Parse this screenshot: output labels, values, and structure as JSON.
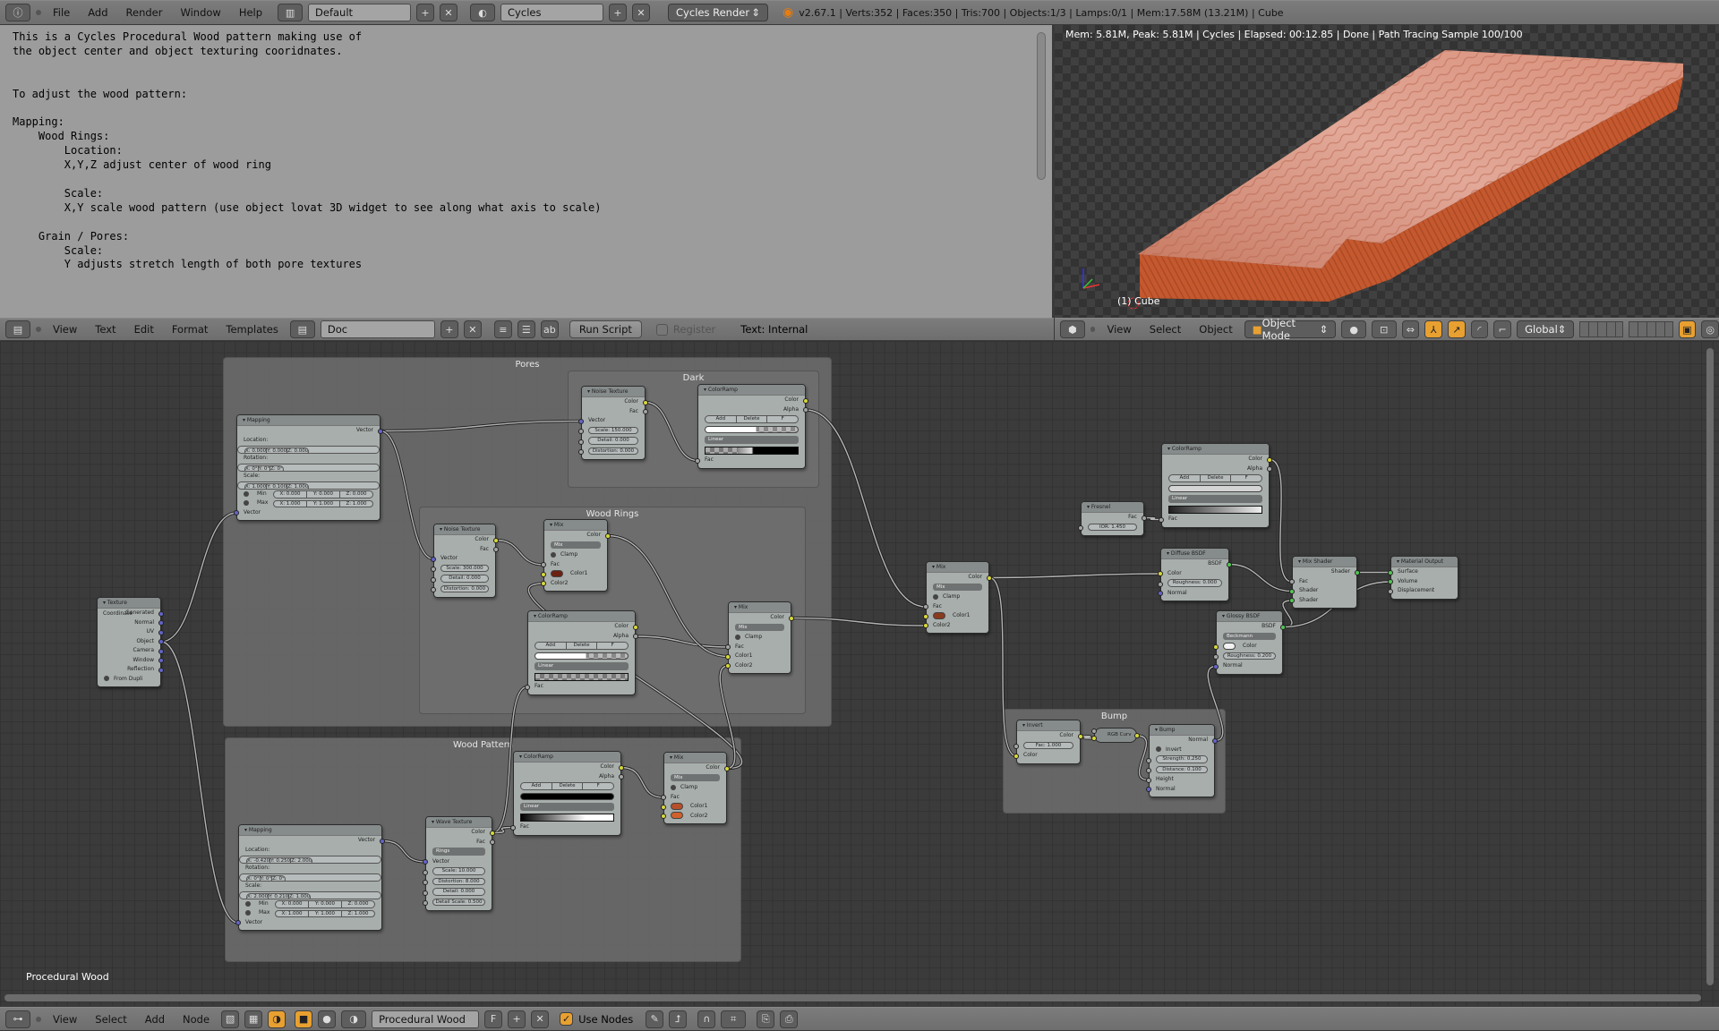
{
  "topbar": {
    "menus": [
      "File",
      "Add",
      "Render",
      "Window",
      "Help"
    ],
    "screen_layout": "Default",
    "scene": "Cycles",
    "render_engine": "Cycles Render",
    "stats": "v2.67.1 | Verts:352 | Faces:350 | Tris:700 | Objects:1/3 | Lamps:0/1 | Mem:17.58M (13.21M) | Cube"
  },
  "text_editor": {
    "lines": [
      "This is a Cycles Procedural Wood pattern making use of",
      "the object center and object texturing cooridnates.",
      "",
      "",
      "To adjust the wood pattern:",
      "",
      "Mapping:",
      "    Wood Rings:",
      "        Location:",
      "        X,Y,Z adjust center of wood ring",
      "",
      "        Scale:",
      "        X,Y scale wood pattern (use object lovat 3D widget to see along what axis to scale)",
      "",
      "    Grain / Pores:",
      "        Scale:",
      "        Y adjusts stretch length of both pore textures"
    ],
    "header": {
      "menus": [
        "View",
        "Text",
        "Edit",
        "Format",
        "Templates"
      ],
      "datablock": "Doc",
      "run_script": "Run Script",
      "register": "Register",
      "register_checked": false,
      "status": "Text: Internal"
    }
  },
  "viewport": {
    "render_info": "Mem: 5.81M, Peak: 5.81M | Cycles | Elapsed: 00:12.85 | Done | Path Tracing Sample 100/100",
    "object_label": "(1) Cube",
    "header": {
      "menus": [
        "View",
        "Select",
        "Object"
      ],
      "mode": "Object Mode",
      "orientation": "Global"
    },
    "colors": {
      "top": "#d99a88",
      "side": "#c4582e",
      "grain": "#b8624c"
    }
  },
  "node_editor": {
    "material_label": "Procedural Wood",
    "frames": {
      "pores": "Pores",
      "dark": "Dark",
      "wood_rings": "Wood Rings",
      "wood_pattern": "Wood Pattern",
      "bump": "Bump"
    },
    "nodes": {
      "texcoord": {
        "title": "Texture Coordinate",
        "rows": [
          {
            "t": "out",
            "l": "Generated",
            "s": "v"
          },
          {
            "t": "out",
            "l": "Normal",
            "s": "v"
          },
          {
            "t": "out",
            "l": "UV",
            "s": "v"
          },
          {
            "t": "out",
            "l": "Object",
            "s": "v"
          },
          {
            "t": "out",
            "l": "Camera",
            "s": "v"
          },
          {
            "t": "out",
            "l": "Window",
            "s": "v"
          },
          {
            "t": "out",
            "l": "Reflection",
            "s": "v"
          },
          {
            "t": "check",
            "l": "From Dupli"
          }
        ]
      },
      "mapping1": {
        "title": "Mapping",
        "rows": [
          {
            "t": "out",
            "l": "Vector",
            "s": "v"
          },
          {
            "t": "label",
            "l": "Location:"
          },
          {
            "t": "tri",
            "v": [
              "X: 0.000",
              "Y: 0.000",
              "Z: 0.000"
            ]
          },
          {
            "t": "label",
            "l": "Rotation:"
          },
          {
            "t": "tri",
            "v": [
              "X: 0°",
              "Y: 0°",
              "Z: 0°"
            ]
          },
          {
            "t": "label",
            "l": "Scale:"
          },
          {
            "t": "tri",
            "v": [
              "X: 1.000",
              "Y: 0.100",
              "Z: 1.000"
            ]
          },
          {
            "t": "minmax",
            "l": "Min",
            "v": [
              "X: 0.000",
              "Y: 0.000",
              "Z: 0.000"
            ]
          },
          {
            "t": "minmax",
            "l": "Max",
            "v": [
              "X: 1.000",
              "Y: 1.000",
              "Z: 1.000"
            ]
          },
          {
            "t": "in",
            "l": "Vector",
            "s": "v"
          }
        ]
      },
      "noiseDark": {
        "title": "Noise Texture",
        "rows": [
          {
            "t": "out",
            "l": "Color",
            "s": "c"
          },
          {
            "t": "out",
            "l": "Fac",
            "s": "f"
          },
          {
            "t": "in",
            "l": "Vector",
            "s": "v"
          },
          {
            "t": "infield",
            "l": "Scale: 150.000",
            "s": "f"
          },
          {
            "t": "infield",
            "l": "Detail: 0.000",
            "s": "f"
          },
          {
            "t": "infield",
            "l": "Distortion: 0.000",
            "s": "f"
          }
        ]
      },
      "rampDark": {
        "title": "ColorRamp",
        "rows": [
          {
            "t": "out",
            "l": "Color",
            "s": "c"
          },
          {
            "t": "out",
            "l": "Alpha",
            "s": "f"
          },
          {
            "t": "buttons",
            "v": [
              "Add",
              "Delete",
              "F"
            ]
          },
          {
            "t": "colorbar",
            "k": "white_checker"
          },
          {
            "t": "dropdown",
            "l": "Linear"
          },
          {
            "t": "ramp",
            "k": "checker_black"
          },
          {
            "t": "in",
            "l": "Fac",
            "s": "f"
          }
        ]
      },
      "noiseWR": {
        "title": "Noise Texture",
        "rows": [
          {
            "t": "out",
            "l": "Color",
            "s": "c"
          },
          {
            "t": "out",
            "l": "Fac",
            "s": "f"
          },
          {
            "t": "in",
            "l": "Vector",
            "s": "v"
          },
          {
            "t": "infield",
            "l": "Scale: 300.000",
            "s": "f"
          },
          {
            "t": "infield",
            "l": "Detail: 0.000",
            "s": "f"
          },
          {
            "t": "infield",
            "l": "Distortion: 0.000",
            "s": "f"
          }
        ]
      },
      "mixWR1": {
        "title": "Mix",
        "rows": [
          {
            "t": "out",
            "l": "Color",
            "s": "c"
          },
          {
            "t": "dropdown",
            "l": "Mix"
          },
          {
            "t": "check",
            "l": "Clamp"
          },
          {
            "t": "in",
            "l": "Fac",
            "s": "f"
          },
          {
            "t": "colorin",
            "l": "Color1",
            "s": "c",
            "color": "#6b2210"
          },
          {
            "t": "in",
            "l": "Color2",
            "s": "c"
          }
        ]
      },
      "rampWR": {
        "title": "ColorRamp",
        "rows": [
          {
            "t": "out",
            "l": "Color",
            "s": "c"
          },
          {
            "t": "out",
            "l": "Alpha",
            "s": "f"
          },
          {
            "t": "buttons",
            "v": [
              "Add",
              "Delete",
              "F"
            ]
          },
          {
            "t": "colorbar",
            "k": "white_checker"
          },
          {
            "t": "dropdown",
            "l": "Linear"
          },
          {
            "t": "ramp",
            "k": "checker"
          },
          {
            "t": "in",
            "l": "Fac",
            "s": "f"
          }
        ]
      },
      "mixWR2": {
        "title": "Mix",
        "rows": [
          {
            "t": "out",
            "l": "Color",
            "s": "c"
          },
          {
            "t": "dropdown",
            "l": "Mix"
          },
          {
            "t": "check",
            "l": "Clamp"
          },
          {
            "t": "in",
            "l": "Fac",
            "s": "f"
          },
          {
            "t": "in",
            "l": "Color1",
            "s": "c"
          },
          {
            "t": "in",
            "l": "Color2",
            "s": "c"
          }
        ]
      },
      "mapping2": {
        "title": "Mapping",
        "rows": [
          {
            "t": "out",
            "l": "Vector",
            "s": "v"
          },
          {
            "t": "label",
            "l": "Location:"
          },
          {
            "t": "tri",
            "v": [
              "X: -0.420",
              "Y: 0.250",
              "Z: 2.000"
            ]
          },
          {
            "t": "label",
            "l": "Rotation:"
          },
          {
            "t": "tri",
            "v": [
              "X: 0°",
              "Y: 0°",
              "Z: 0°"
            ]
          },
          {
            "t": "label",
            "l": "Scale:"
          },
          {
            "t": "tri",
            "v": [
              "X: 2.000",
              "Y: 0.210",
              "Z: 1.000"
            ]
          },
          {
            "t": "minmax",
            "l": "Min",
            "v": [
              "X: 0.000",
              "Y: 0.000",
              "Z: 0.000"
            ]
          },
          {
            "t": "minmax",
            "l": "Max",
            "v": [
              "X: 1.000",
              "Y: 1.000",
              "Z: 1.000"
            ]
          },
          {
            "t": "in",
            "l": "Vector",
            "s": "v"
          }
        ]
      },
      "wave": {
        "title": "Wave Texture",
        "rows": [
          {
            "t": "out",
            "l": "Color",
            "s": "c"
          },
          {
            "t": "out",
            "l": "Fac",
            "s": "f"
          },
          {
            "t": "dropdown",
            "l": "Rings"
          },
          {
            "t": "in",
            "l": "Vector",
            "s": "v"
          },
          {
            "t": "infield",
            "l": "Scale: 10.000",
            "s": "f"
          },
          {
            "t": "infield",
            "l": "Distortion: 8.000",
            "s": "f"
          },
          {
            "t": "infield",
            "l": "Detail: 0.000",
            "s": "f"
          },
          {
            "t": "infield",
            "l": "Detail Scale: 0.500",
            "s": "f"
          }
        ]
      },
      "rampWP": {
        "title": "ColorRamp",
        "rows": [
          {
            "t": "out",
            "l": "Color",
            "s": "c"
          },
          {
            "t": "out",
            "l": "Alpha",
            "s": "f"
          },
          {
            "t": "buttons",
            "v": [
              "Add",
              "Delete",
              "F"
            ]
          },
          {
            "t": "colorbar",
            "k": "black"
          },
          {
            "t": "dropdown",
            "l": "Linear"
          },
          {
            "t": "ramp",
            "k": "black_white"
          },
          {
            "t": "in",
            "l": "Fac",
            "s": "f"
          }
        ]
      },
      "mixWP": {
        "title": "Mix",
        "rows": [
          {
            "t": "out",
            "l": "Color",
            "s": "c"
          },
          {
            "t": "dropdown",
            "l": "Mix"
          },
          {
            "t": "check",
            "l": "Clamp"
          },
          {
            "t": "in",
            "l": "Fac",
            "s": "f"
          },
          {
            "t": "colorin",
            "l": "Color1",
            "s": "c",
            "color": "#b5502a"
          },
          {
            "t": "colorin",
            "l": "Color2",
            "s": "c",
            "color": "#d0602c"
          }
        ]
      },
      "mixMain": {
        "title": "Mix",
        "rows": [
          {
            "t": "out",
            "l": "Color",
            "s": "c"
          },
          {
            "t": "dropdown",
            "l": "Mix"
          },
          {
            "t": "check",
            "l": "Clamp"
          },
          {
            "t": "in",
            "l": "Fac",
            "s": "f"
          },
          {
            "t": "colorin",
            "l": "Color1",
            "s": "c",
            "color": "#8a3a1e"
          },
          {
            "t": "in",
            "l": "Color2",
            "s": "c"
          }
        ]
      },
      "fresnel": {
        "title": "Fresnel",
        "rows": [
          {
            "t": "out",
            "l": "Fac",
            "s": "f"
          },
          {
            "t": "infield",
            "l": "IOR: 1.450",
            "s": "f"
          }
        ]
      },
      "rampRight": {
        "title": "ColorRamp",
        "rows": [
          {
            "t": "out",
            "l": "Color",
            "s": "c"
          },
          {
            "t": "out",
            "l": "Alpha",
            "s": "f"
          },
          {
            "t": "buttons",
            "v": [
              "Add",
              "Delete",
              "F"
            ]
          },
          {
            "t": "colorbar",
            "k": "light"
          },
          {
            "t": "dropdown",
            "l": "Linear"
          },
          {
            "t": "ramp",
            "k": "dark_white"
          },
          {
            "t": "in",
            "l": "Fac",
            "s": "f"
          }
        ]
      },
      "diffuse": {
        "title": "Diffuse BSDF",
        "rows": [
          {
            "t": "out",
            "l": "BSDF",
            "s": "s"
          },
          {
            "t": "in",
            "l": "Color",
            "s": "c"
          },
          {
            "t": "infield",
            "l": "Roughness: 0.000",
            "s": "f"
          },
          {
            "t": "in",
            "l": "Normal",
            "s": "v"
          }
        ]
      },
      "glossy": {
        "title": "Glossy BSDF",
        "rows": [
          {
            "t": "out",
            "l": "BSDF",
            "s": "s"
          },
          {
            "t": "dropdown",
            "l": "Beckmann"
          },
          {
            "t": "colorin",
            "l": "Color",
            "s": "c",
            "color": "#f2f2f2"
          },
          {
            "t": "infield",
            "l": "Roughness: 0.200",
            "s": "f"
          },
          {
            "t": "in",
            "l": "Normal",
            "s": "v"
          }
        ]
      },
      "mixShader": {
        "title": "Mix Shader",
        "rows": [
          {
            "t": "out",
            "l": "Shader",
            "s": "s"
          },
          {
            "t": "in",
            "l": "Fac",
            "s": "f"
          },
          {
            "t": "in",
            "l": "Shader",
            "s": "s"
          },
          {
            "t": "in",
            "l": "Shader",
            "s": "s"
          }
        ]
      },
      "output": {
        "title": "Material Output",
        "rows": [
          {
            "t": "in",
            "l": "Surface",
            "s": "s"
          },
          {
            "t": "in",
            "l": "Volume",
            "s": "s"
          },
          {
            "t": "in",
            "l": "Displacement",
            "s": "f"
          }
        ]
      },
      "invert": {
        "title": "Invert",
        "rows": [
          {
            "t": "out",
            "l": "Color",
            "s": "c"
          },
          {
            "t": "infield",
            "l": "Fac: 1.000",
            "s": "f"
          },
          {
            "t": "in",
            "l": "Color",
            "s": "c"
          }
        ]
      },
      "curves": {
        "title": "RGB Curv",
        "collapsed": true,
        "rows": [
          {
            "t": "in",
            "l": "Fac",
            "s": "f"
          },
          {
            "t": "in",
            "l": "Color",
            "s": "c"
          },
          {
            "t": "out",
            "l": "Color",
            "s": "c"
          }
        ]
      },
      "bump": {
        "title": "Bump",
        "rows": [
          {
            "t": "out",
            "l": "Normal",
            "s": "v"
          },
          {
            "t": "check",
            "l": "Invert"
          },
          {
            "t": "infield",
            "l": "Strength: 0.250",
            "s": "f"
          },
          {
            "t": "infield",
            "l": "Distance: 0.100",
            "s": "f"
          },
          {
            "t": "in",
            "l": "Height",
            "s": "f"
          },
          {
            "t": "in",
            "l": "Normal",
            "s": "v"
          }
        ]
      }
    },
    "links": [
      [
        "texcoord",
        3,
        "mapping1",
        9
      ],
      [
        "texcoord",
        3,
        "mapping2",
        9
      ],
      [
        "mapping1",
        0,
        "noiseDark",
        2
      ],
      [
        "mapping1",
        0,
        "noiseWR",
        2
      ],
      [
        "noiseDark",
        0,
        "rampDark",
        6
      ],
      [
        "rampDark",
        1,
        "mixMain",
        3
      ],
      [
        "noiseWR",
        0,
        "mixWR1",
        3
      ],
      [
        "mixWP",
        0,
        "mixWR1",
        5
      ],
      [
        "wave",
        0,
        "rampWR",
        6
      ],
      [
        "rampWR",
        1,
        "mixWR2",
        3
      ],
      [
        "mixWR1",
        0,
        "mixWR2",
        4
      ],
      [
        "mixWP",
        0,
        "mixWR2",
        5
      ],
      [
        "mixWR2",
        0,
        "mixMain",
        5
      ],
      [
        "mapping2",
        0,
        "wave",
        3
      ],
      [
        "wave",
        0,
        "rampWP",
        6
      ],
      [
        "rampWP",
        0,
        "mixWP",
        3
      ],
      [
        "mixMain",
        0,
        "diffuse",
        1
      ],
      [
        "mixMain",
        0,
        "invert",
        2
      ],
      [
        "fresnel",
        0,
        "rampRight",
        6
      ],
      [
        "rampRight",
        0,
        "mixShader",
        1
      ],
      [
        "diffuse",
        0,
        "mixShader",
        2
      ],
      [
        "glossy",
        0,
        "mixShader",
        3
      ],
      [
        "mixShader",
        0,
        "output",
        0
      ],
      [
        "glossy",
        0,
        "output",
        1
      ],
      [
        "invert",
        0,
        "curves",
        1
      ],
      [
        "curves",
        2,
        "bump",
        4
      ],
      [
        "bump",
        0,
        "glossy",
        4
      ]
    ],
    "header": {
      "menus": [
        "View",
        "Select",
        "Add",
        "Node"
      ],
      "material": "Procedural Wood",
      "fake_user": "F",
      "use_nodes_label": "Use Nodes",
      "use_nodes": true
    }
  }
}
